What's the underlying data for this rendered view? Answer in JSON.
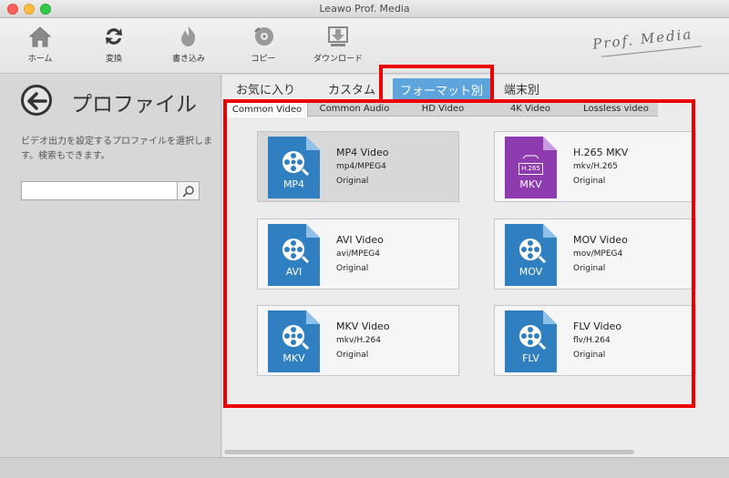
{
  "window": {
    "title": "Leawo Prof. Media"
  },
  "toolbar": {
    "items": [
      {
        "label": "ホーム",
        "icon": "home-icon"
      },
      {
        "label": "変換",
        "icon": "convert-icon"
      },
      {
        "label": "書き込み",
        "icon": "burn-icon"
      },
      {
        "label": "コピー",
        "icon": "copy-disc-icon"
      },
      {
        "label": "ダウンロード",
        "icon": "download-icon"
      }
    ],
    "brand": "Prof. Media"
  },
  "sidebar": {
    "title": "プロファイル",
    "description": "ビデオ出力を設定するプロファイルを選択します。検索もできます。",
    "search": {
      "value": "",
      "placeholder": ""
    }
  },
  "tabs": [
    {
      "label": "お気に入り"
    },
    {
      "label": "カスタム"
    },
    {
      "label": "フォーマット別"
    },
    {
      "label": "端末別"
    }
  ],
  "active_tab": "フォーマット別",
  "subtabs": [
    {
      "label": "Common Video"
    },
    {
      "label": "Common Audio"
    },
    {
      "label": "HD Video"
    },
    {
      "label": "4K Video"
    },
    {
      "label": "Lossless video"
    }
  ],
  "active_subtab": "Common Video",
  "formats": [
    {
      "name": "MP4 Video",
      "codec": "mp4/MPEG4",
      "quality": "Original",
      "label": "MP4",
      "color": "#2f7fc1"
    },
    {
      "name": "H.265 MKV",
      "codec": "mkv/H.265",
      "quality": "Original",
      "label": "MKV",
      "badge": "H.265",
      "color": "#8e3bb0"
    },
    {
      "name": "AVI Video",
      "codec": "avi/MPEG4",
      "quality": "Original",
      "label": "AVI",
      "color": "#2f7fc1"
    },
    {
      "name": "MOV Video",
      "codec": "mov/MPEG4",
      "quality": "Original",
      "label": "MOV",
      "color": "#2f7fc1"
    },
    {
      "name": "MKV Video",
      "codec": "mkv/H.264",
      "quality": "Original",
      "label": "MKV",
      "color": "#2f7fc1"
    },
    {
      "name": "FLV Video",
      "codec": "flv/H.264",
      "quality": "Original",
      "label": "FLV",
      "color": "#2f7fc1"
    }
  ],
  "colors": {
    "highlight": "#ee0000",
    "tab_active": "#5ea4dd",
    "file_blue": "#2f7fc1",
    "file_purple": "#8e3bb0"
  }
}
